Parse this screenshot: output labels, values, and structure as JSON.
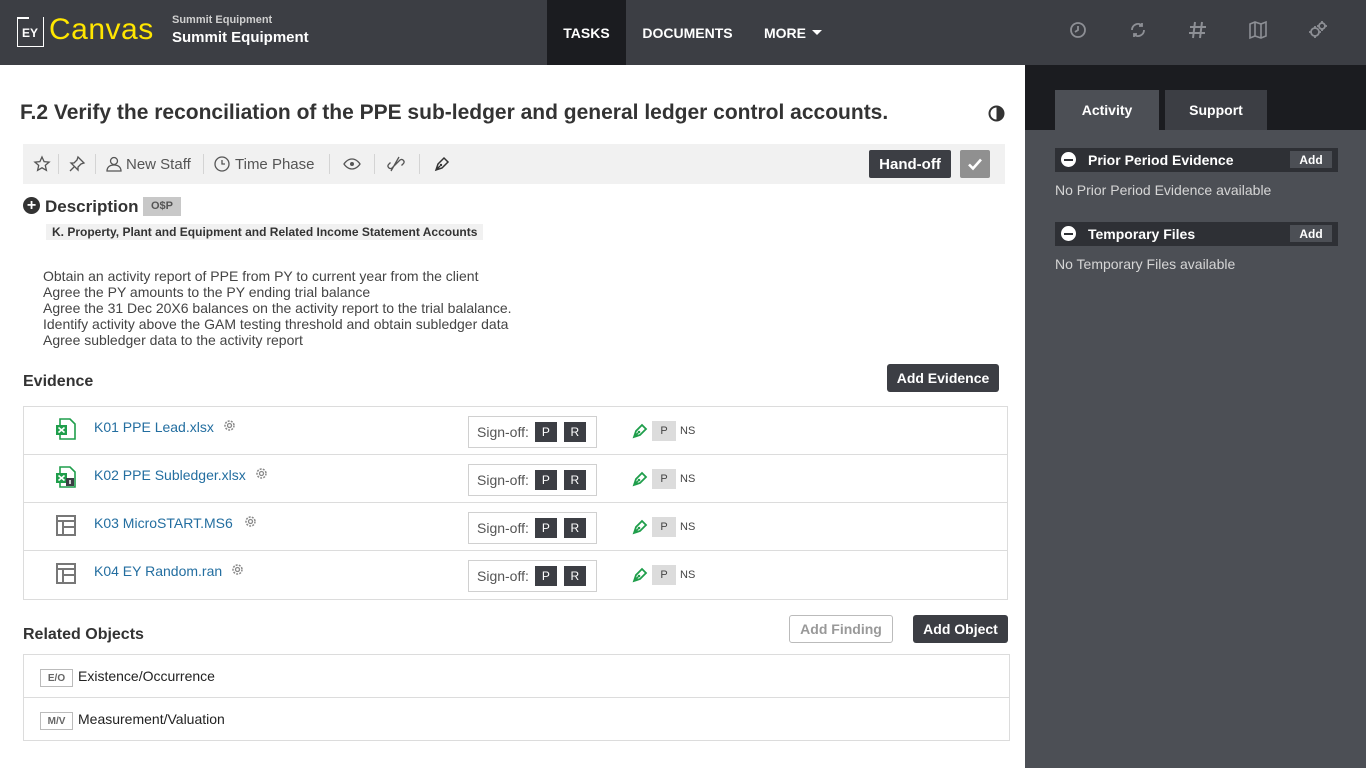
{
  "header": {
    "logo_mark": "EY",
    "app_name": "Canvas",
    "client_small": "Summit Equipment",
    "client_big": "Summit Equipment",
    "nav": {
      "tasks": "TASKS",
      "documents": "DOCUMENTS",
      "more": "MORE"
    },
    "icons": [
      "time-icon",
      "sync-icon",
      "hash-icon",
      "map-icon",
      "gear-cluster-icon"
    ]
  },
  "task": {
    "title": "F.2 Verify the reconciliation of the PPE sub-ledger and general ledger control accounts."
  },
  "toolbar": {
    "new_staff": "New Staff",
    "time_phase": "Time Phase",
    "handoff": "Hand-off"
  },
  "description": {
    "label": "Description",
    "badge": "O$P",
    "area": "K. Property, Plant and Equipment and Related Income Statement Accounts",
    "lines": [
      "Obtain an activity report of PPE from PY to current year from the client",
      "Agree the PY amounts to the PY ending trial balance",
      "Agree the 31 Dec 20X6 balances on the activity report to the trial balalance.",
      "Identify activity above the GAM testing threshold and obtain subledger data",
      "Agree subledger data to the activity report"
    ]
  },
  "evidence": {
    "heading": "Evidence",
    "add_button": "Add Evidence",
    "signoff_label": "Sign-off:",
    "p_label": "P",
    "r_label": "R",
    "status_p": "P",
    "status_ns": "NS",
    "items": [
      {
        "name": "K01 PPE Lead.xlsx",
        "icon": "excel-icon"
      },
      {
        "name": "K02 PPE Subledger.xlsx",
        "icon": "excel-linked-icon"
      },
      {
        "name": "K03 MicroSTART.MS6",
        "icon": "form-icon"
      },
      {
        "name": "K04 EY Random.ran",
        "icon": "form-icon"
      }
    ]
  },
  "related": {
    "heading": "Related Objects",
    "add_finding": "Add Finding",
    "add_object": "Add Object",
    "items": [
      {
        "tag": "E/O",
        "name": "Existence/Occurrence"
      },
      {
        "tag": "M/V",
        "name": "Measurement/Valuation"
      }
    ]
  },
  "side": {
    "tabs": {
      "activity": "Activity",
      "support": "Support"
    },
    "prior": {
      "title": "Prior Period Evidence",
      "add": "Add",
      "empty": "No Prior Period Evidence available"
    },
    "temp": {
      "title": "Temporary Files",
      "add": "Add",
      "empty": "No Temporary Files available"
    }
  },
  "colors": {
    "brand_yellow": "#ffe600",
    "dark": "#3c3e44",
    "link": "#236ea0",
    "excel_green": "#1f9e4b"
  }
}
